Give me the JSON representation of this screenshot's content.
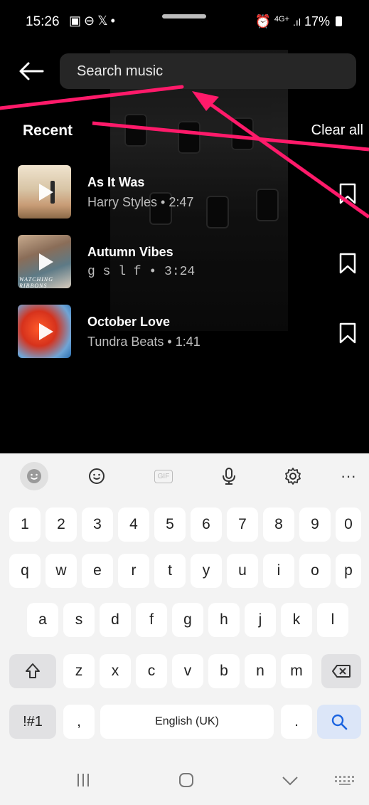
{
  "status_bar": {
    "time": "15:26",
    "left_icons": "▣⊖𝕏•",
    "network": "4G+",
    "battery": "17%"
  },
  "search": {
    "placeholder": "Search music"
  },
  "section": {
    "title": "Recent",
    "clear_label": "Clear all"
  },
  "tracks": [
    {
      "title": "As It Was",
      "subtitle": "Harry Styles • 2:47"
    },
    {
      "title": "Autumn Vibes",
      "subtitle": "g s l f • 3:24",
      "cover_text": "WATCHING RIBBONS"
    },
    {
      "title": "October Love",
      "subtitle": "Tundra Beats • 1:41"
    }
  ],
  "keyboard": {
    "toolbar": [
      "emoji-face-icon",
      "smiley-icon",
      "gif-icon",
      "microphone-icon",
      "settings-gear-icon",
      "more-icon"
    ],
    "gif_label": "GIF",
    "more_label": "···",
    "row_numbers": [
      "1",
      "2",
      "3",
      "4",
      "5",
      "6",
      "7",
      "8",
      "9",
      "0"
    ],
    "row_q": [
      "q",
      "w",
      "e",
      "r",
      "t",
      "y",
      "u",
      "i",
      "o",
      "p"
    ],
    "row_a": [
      "a",
      "s",
      "d",
      "f",
      "g",
      "h",
      "j",
      "k",
      "l"
    ],
    "row_z": [
      "z",
      "x",
      "c",
      "v",
      "b",
      "n",
      "m"
    ],
    "symbols_label": "!#1",
    "comma_label": ",",
    "space_label": "English (UK)",
    "period_label": ".",
    "accent_color": "#1b64e0"
  },
  "annotation_color": "#ff1a6a"
}
